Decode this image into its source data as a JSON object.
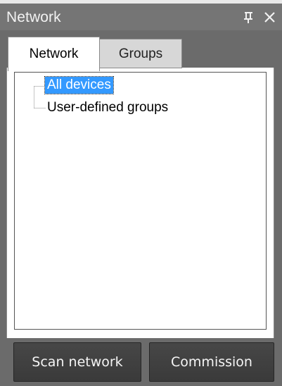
{
  "window": {
    "title": "Network",
    "pin_icon": "pin-icon",
    "close_icon": "close-icon"
  },
  "tabs": [
    {
      "label": "Network",
      "selected": true
    },
    {
      "label": "Groups",
      "selected": false
    }
  ],
  "tree": {
    "items": [
      {
        "label": "All devices",
        "selected": true
      },
      {
        "label": "User-defined groups",
        "selected": false
      }
    ]
  },
  "buttons": {
    "scan_label": "Scan network",
    "commission_label": "Commission"
  },
  "colors": {
    "title_bar": "#757575",
    "panel": "#6b6b6b",
    "selection": "#3399ff",
    "button": "#3f3f3f"
  }
}
